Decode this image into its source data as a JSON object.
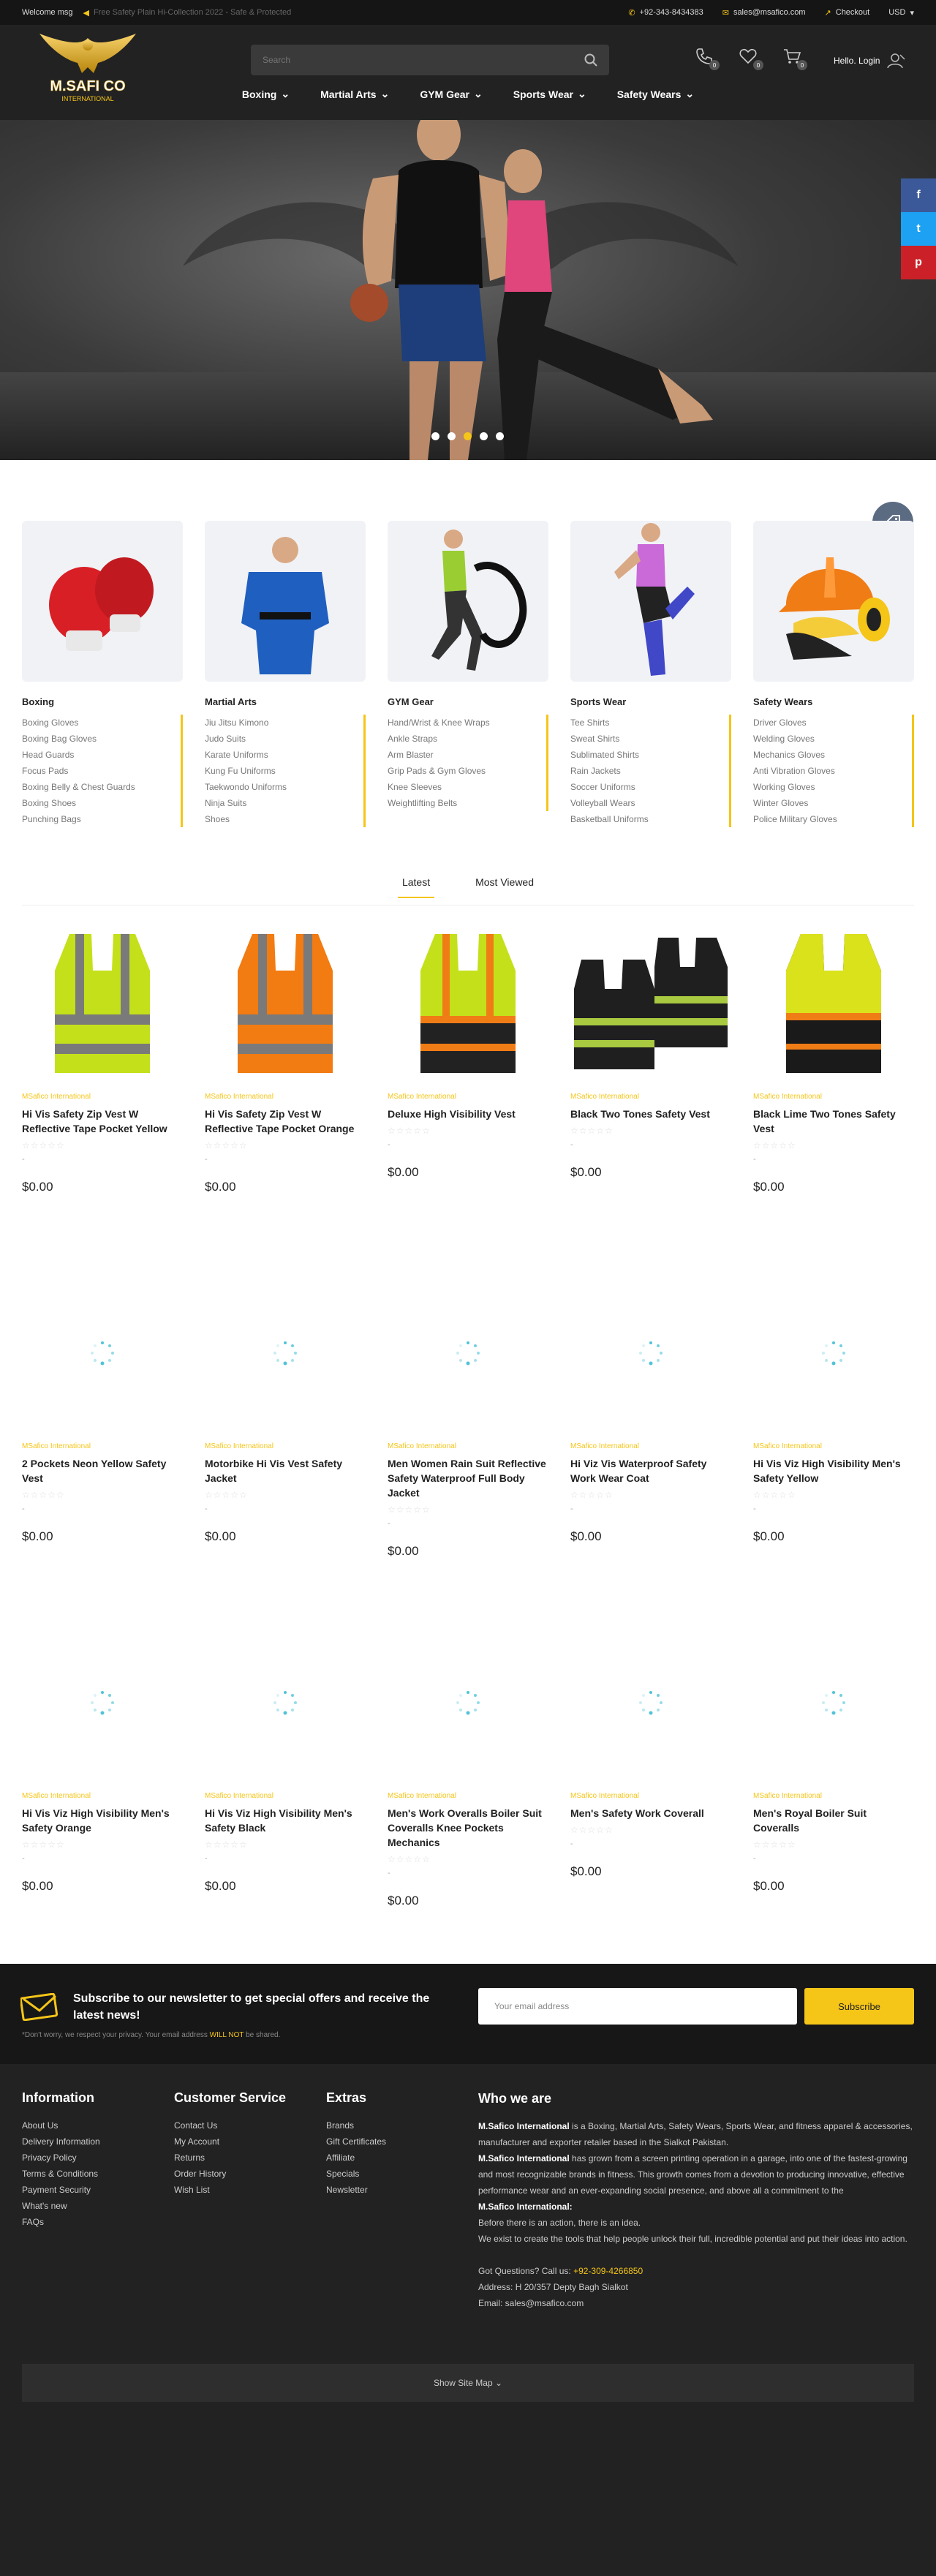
{
  "topbar": {
    "welcome": "Welcome msg",
    "promo": "Free Safety Plain Hi-Collection 2022 - Safe & Protected",
    "phone": "+92-343-8434383",
    "email": "sales@msafico.com",
    "checkout": "Checkout",
    "currency": "USD"
  },
  "header": {
    "logo_main": "M.SAFI CO",
    "logo_sub": "INTERNATIONAL",
    "search_placeholder": "Search",
    "compare_count": "0",
    "wishlist_count": "0",
    "cart_count": "0",
    "login": "Hello. Login"
  },
  "nav": [
    "Boxing",
    "Martial Arts",
    "GYM Gear",
    "Sports Wear",
    "Safety Wears"
  ],
  "hero": {
    "slides": 5,
    "active_slide": 3
  },
  "social": [
    "f",
    "t",
    "p"
  ],
  "categories": [
    {
      "title": "Boxing",
      "items": [
        "Boxing Gloves",
        "Boxing Bag Gloves",
        "Head Guards",
        "Focus Pads",
        "Boxing Belly & Chest Guards",
        "Boxing Shoes",
        "Punching Bags"
      ]
    },
    {
      "title": "Martial Arts",
      "items": [
        "Jiu Jitsu Kimono",
        "Judo Suits",
        "Karate Uniforms",
        "Kung Fu Uniforms",
        "Taekwondo Uniforms",
        "Ninja Suits",
        "Shoes"
      ]
    },
    {
      "title": "GYM Gear",
      "items": [
        "Hand/Wrist & Knee Wraps",
        "Ankle Straps",
        "Arm Blaster",
        "Grip Pads & Gym Gloves",
        "Knee Sleeves",
        "Weightlifting Belts"
      ]
    },
    {
      "title": "Sports Wear",
      "items": [
        "Tee Shirts",
        "Sweat Shirts",
        "Sublimated Shirts",
        "Rain Jackets",
        "Soccer Uniforms",
        "Volleyball Wears",
        "Basketball Uniforms"
      ]
    },
    {
      "title": "Safety Wears",
      "items": [
        "Driver Gloves",
        "Welding Gloves",
        "Mechanics Gloves",
        "Anti Vibration Gloves",
        "Working Gloves",
        "Winter Gloves",
        "Police Military Gloves"
      ]
    }
  ],
  "tabs": [
    "Latest",
    "Most Viewed"
  ],
  "products": [
    {
      "brand": "MSafico International",
      "name": "Hi Vis Safety Zip Vest W Reflective Tape Pocket Yellow",
      "price": "$0.00",
      "image": "yellow-vest"
    },
    {
      "brand": "MSafico International",
      "name": "Hi Vis Safety Zip Vest W Reflective Tape Pocket Orange",
      "price": "$0.00",
      "image": "orange-vest"
    },
    {
      "brand": "MSafico International",
      "name": "Deluxe High Visibility Vest",
      "price": "$0.00",
      "image": "deluxe-vest"
    },
    {
      "brand": "MSafico International",
      "name": "Black Two Tones Safety Vest",
      "price": "$0.00",
      "image": "black-two-tone-vest"
    },
    {
      "brand": "MSafico International",
      "name": "Black Lime Two Tones Safety Vest",
      "price": "$0.00",
      "image": "black-lime-vest"
    },
    {
      "brand": "MSafico International",
      "name": "2 Pockets Neon Yellow Safety Vest",
      "price": "$0.00",
      "image": "loading"
    },
    {
      "brand": "MSafico International",
      "name": "Motorbike Hi Vis Vest Safety Jacket",
      "price": "$0.00",
      "image": "loading"
    },
    {
      "brand": "MSafico International",
      "name": "Men Women Rain Suit Reflective Safety Waterproof Full Body Jacket",
      "price": "$0.00",
      "image": "loading"
    },
    {
      "brand": "MSafico International",
      "name": "Hi Viz Vis Waterproof Safety Work Wear Coat",
      "price": "$0.00",
      "image": "loading"
    },
    {
      "brand": "MSafico International",
      "name": "Hi Vis Viz High Visibility Men's Safety Yellow",
      "price": "$0.00",
      "image": "loading"
    },
    {
      "brand": "MSafico International",
      "name": "Hi Vis Viz High Visibility Men's Safety Orange",
      "price": "$0.00",
      "image": "loading"
    },
    {
      "brand": "MSafico International",
      "name": "Hi Vis Viz High Visibility Men's Safety Black",
      "price": "$0.00",
      "image": "loading"
    },
    {
      "brand": "MSafico International",
      "name": "Men's Work Overalls Boiler Suit Coveralls Knee Pockets Mechanics",
      "price": "$0.00",
      "image": "loading"
    },
    {
      "brand": "MSafico International",
      "name": "Men's Safety Work Coverall",
      "price": "$0.00",
      "image": "loading"
    },
    {
      "brand": "MSafico International",
      "name": "Men's Royal Boiler Suit Coveralls",
      "price": "$0.00",
      "image": "loading"
    }
  ],
  "newsletter": {
    "title": "Subscribe to our newsletter to get special offers and receive the latest news!",
    "note_before": "*Don't worry, we respect your privacy. Your email address ",
    "note_highlight": "WILL NOT",
    "note_after": " be shared.",
    "placeholder": "Your email address",
    "button": "Subscribe"
  },
  "footer": {
    "information": {
      "title": "Information",
      "links": [
        "About Us",
        "Delivery Information",
        "Privacy Policy",
        "Terms & Conditions",
        "Payment Security",
        "What's new",
        "FAQs"
      ]
    },
    "customer_service": {
      "title": "Customer Service",
      "links": [
        "Contact Us",
        "My Account",
        "Returns",
        "Order History",
        "Wish List"
      ]
    },
    "extras": {
      "title": "Extras",
      "links": [
        "Brands",
        "Gift Certificates",
        "Affiliate",
        "Specials",
        "Newsletter"
      ]
    },
    "who": {
      "title": "Who we are",
      "p1_bold": "M.Safico International",
      "p1": " is a Boxing, Martial Arts, Safety Wears, Sports Wear, and fitness apparel & accessories, manufacturer and exporter retailer based in the Sialkot Pakistan.",
      "p2_bold": "M.Safico International",
      "p2": " has grown from a screen printing operation in a garage, into one of the fastest-growing and most recognizable brands in fitness. This growth comes from a devotion to producing innovative, effective performance wear and an ever-expanding social presence, and above all a commitment to the",
      "p3_bold": "M.Safico International:",
      "p3": "Before there is an action, there is an idea.",
      "p4": "We exist to create the tools that help people unlock their full, incredible potential and put their ideas into action.",
      "questions": "Got Questions? Call us: ",
      "phone": "+92-309-4266850",
      "address": "Address: H 20/357 Depty Bagh Sialkot",
      "email": "Email: sales@msafico.com"
    },
    "sitemap": "Show Site Map ⌄"
  }
}
